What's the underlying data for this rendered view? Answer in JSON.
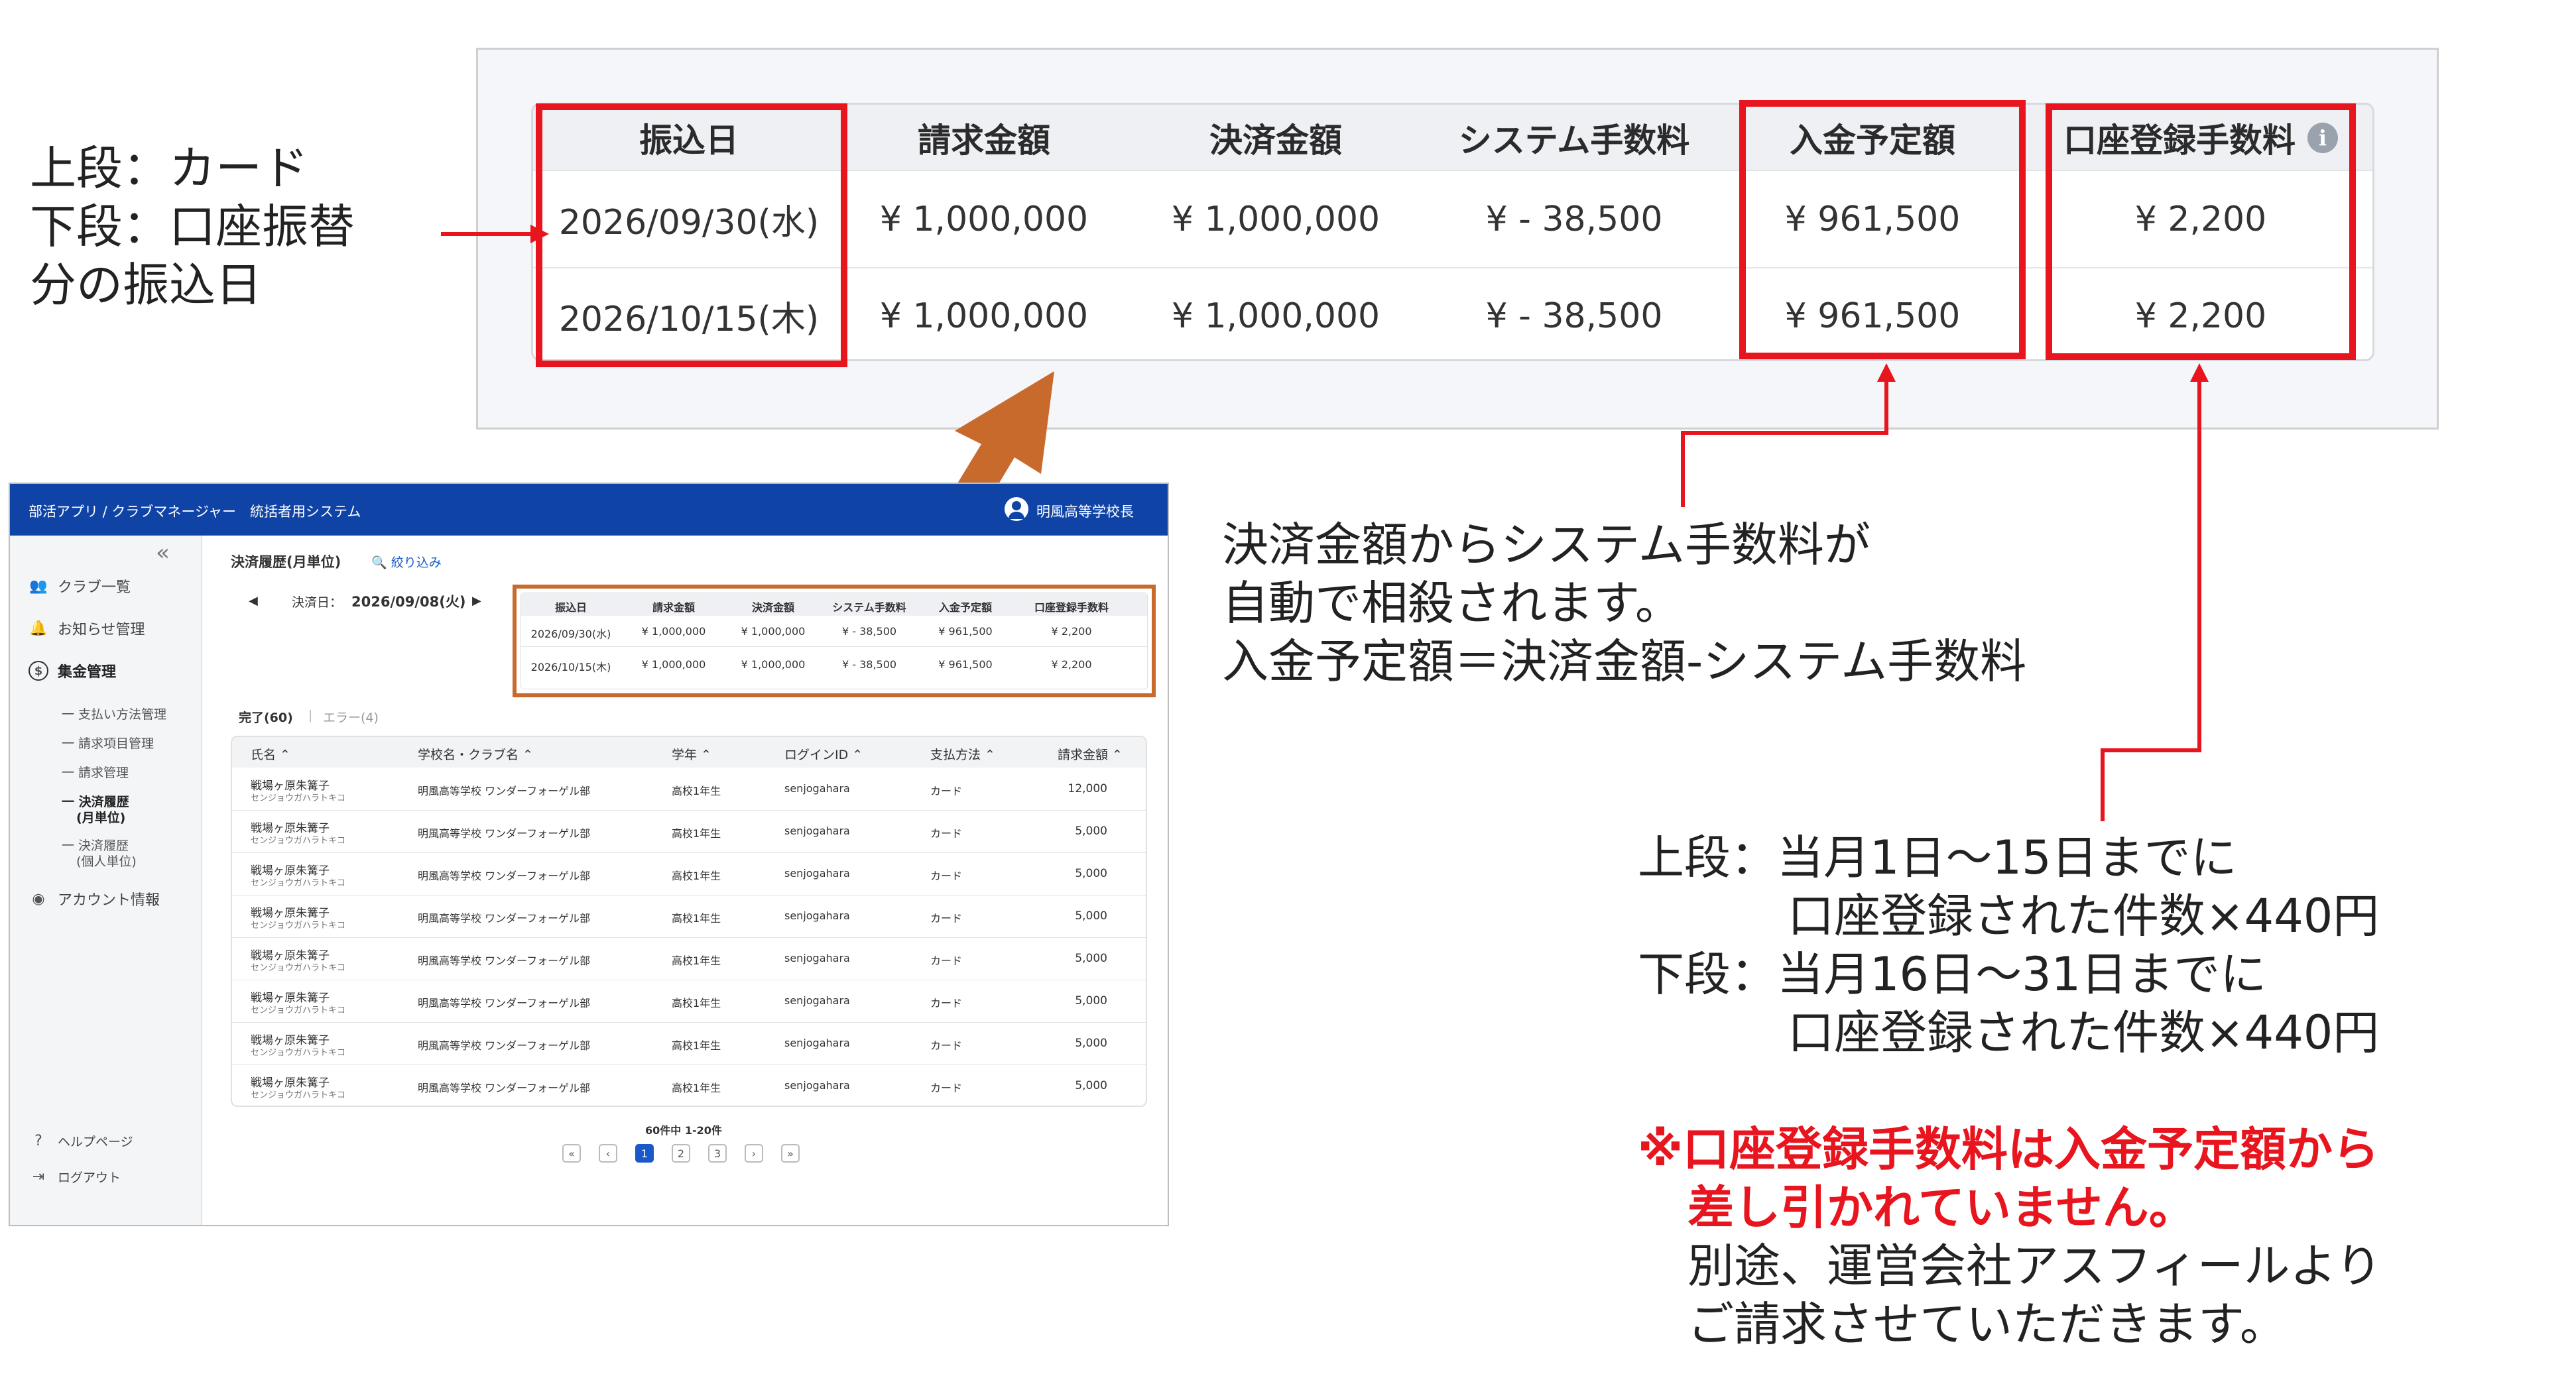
{
  "zoom_table": {
    "headers": [
      "振込日",
      "請求金額",
      "決済金額",
      "システム手数料",
      "入金予定額",
      "口座登録手数料"
    ],
    "info_icon": "i",
    "rows": [
      [
        "2026/09/30(水)",
        "¥ 1,000,000",
        "¥ 1,000,000",
        "¥ - 38,500",
        "¥ 961,500",
        "¥ 2,200"
      ],
      [
        "2026/10/15(木)",
        "¥ 1,000,000",
        "¥ 1,000,000",
        "¥ - 38,500",
        "¥ 961,500",
        "¥ 2,200"
      ]
    ]
  },
  "notes": {
    "left": [
      "上段：カード",
      "下段：口座振替",
      "分の振込日"
    ],
    "middle": [
      "決済金額からシステム手数料が",
      "自動で相殺されます。",
      "入金予定額＝決済金額-システム手数料"
    ],
    "right": [
      "上段：当月1日〜15日までに",
      "口座登録された件数×440円",
      "下段：当月16日〜31日までに",
      "口座登録された件数×440円"
    ],
    "warning": [
      "※口座登録手数料は入金予定額から",
      "差し引かれていません。"
    ],
    "followup": [
      "別途、運営会社アスフィールより",
      "ご請求させていただきます。"
    ]
  },
  "colors": {
    "accent_red": "#e8141e",
    "arrow_orange": "#c86a2c",
    "header_blue": "#0f44a6"
  },
  "mini_app": {
    "header": {
      "title": "部活アプリ / クラブマネージャー　統括者用システム",
      "user": "明風高等学校長"
    },
    "sidebar": {
      "collapse": "«",
      "items": [
        {
          "label": "クラブ一覧",
          "icon": "people-icon"
        },
        {
          "label": "お知らせ管理",
          "icon": "bell-icon"
        },
        {
          "label": "集金管理",
          "icon": "dollar-icon"
        }
      ],
      "sub_items": [
        "一 支払い方法管理",
        "一 請求項目管理",
        "一 請求管理",
        "一 決済履歴",
        "(月単位)",
        "一 決済履歴",
        "(個人単位)"
      ],
      "account": "アカウント情報",
      "help": "ヘルプページ",
      "logout": "ログアウト"
    },
    "page_title": "決済履歴(月単位)",
    "filter": "絞り込み",
    "date_label": "決済日：",
    "date_value": "2026/09/08(火)",
    "summary": {
      "headers": [
        "振込日",
        "請求金額",
        "決済金額",
        "システム手数料",
        "入金予定額",
        "口座登録手数料"
      ],
      "rows": [
        [
          "2026/09/30(水)",
          "¥ 1,000,000",
          "¥ 1,000,000",
          "¥ - 38,500",
          "¥ 961,500",
          "¥ 2,200"
        ],
        [
          "2026/10/15(木)",
          "¥ 1,000,000",
          "¥ 1,000,000",
          "¥ - 38,500",
          "¥ 961,500",
          "¥ 2,200"
        ]
      ]
    },
    "tabs": {
      "done": "完了(60)",
      "sep": "|",
      "error": "エラー(4)"
    },
    "table": {
      "headers": [
        "氏名 ⌃",
        "学校名・クラブ名 ⌃",
        "学年 ⌃",
        "ログインID ⌃",
        "支払方法 ⌃",
        "請求金額 ⌃"
      ],
      "rows": [
        {
          "name": "戦場ヶ原朱篝子",
          "kana": "センジョウガハラトキコ",
          "club": "明風高等学校 ワンダーフォーゲル部",
          "grade": "高校1年生",
          "id": "senjogahara",
          "method": "カード",
          "amount": "12,000"
        },
        {
          "name": "戦場ヶ原朱篝子",
          "kana": "センジョウガハラトキコ",
          "club": "明風高等学校 ワンダーフォーゲル部",
          "grade": "高校1年生",
          "id": "senjogahara",
          "method": "カード",
          "amount": "5,000"
        },
        {
          "name": "戦場ヶ原朱篝子",
          "kana": "センジョウガハラトキコ",
          "club": "明風高等学校 ワンダーフォーゲル部",
          "grade": "高校1年生",
          "id": "senjogahara",
          "method": "カード",
          "amount": "5,000"
        },
        {
          "name": "戦場ヶ原朱篝子",
          "kana": "センジョウガハラトキコ",
          "club": "明風高等学校 ワンダーフォーゲル部",
          "grade": "高校1年生",
          "id": "senjogahara",
          "method": "カード",
          "amount": "5,000"
        },
        {
          "name": "戦場ヶ原朱篝子",
          "kana": "センジョウガハラトキコ",
          "club": "明風高等学校 ワンダーフォーゲル部",
          "grade": "高校1年生",
          "id": "senjogahara",
          "method": "カード",
          "amount": "5,000"
        },
        {
          "name": "戦場ヶ原朱篝子",
          "kana": "センジョウガハラトキコ",
          "club": "明風高等学校 ワンダーフォーゲル部",
          "grade": "高校1年生",
          "id": "senjogahara",
          "method": "カード",
          "amount": "5,000"
        },
        {
          "name": "戦場ヶ原朱篝子",
          "kana": "センジョウガハラトキコ",
          "club": "明風高等学校 ワンダーフォーゲル部",
          "grade": "高校1年生",
          "id": "senjogahara",
          "method": "カード",
          "amount": "5,000"
        },
        {
          "name": "戦場ヶ原朱篝子",
          "kana": "センジョウガハラトキコ",
          "club": "明風高等学校 ワンダーフォーゲル部",
          "grade": "高校1年生",
          "id": "senjogahara",
          "method": "カード",
          "amount": "5,000"
        }
      ]
    },
    "pagination": {
      "summary": "60件中 1-20件",
      "first": "«",
      "prev": "‹",
      "pages": [
        "1",
        "2",
        "3"
      ],
      "next": "›",
      "last": "»"
    }
  }
}
